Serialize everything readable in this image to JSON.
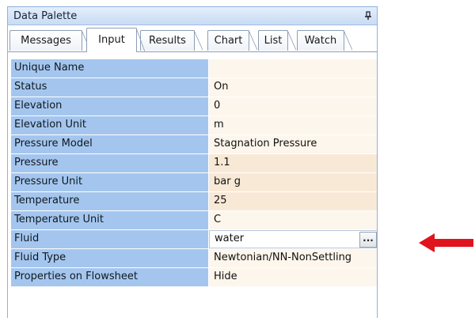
{
  "panel": {
    "title": "Data Palette",
    "pin_icon": "pin-icon"
  },
  "tabs": [
    {
      "label": "Messages",
      "active": false
    },
    {
      "label": "Input",
      "active": true
    },
    {
      "label": "Results",
      "active": false
    },
    {
      "label": "Chart",
      "active": false
    },
    {
      "label": "List",
      "active": false
    },
    {
      "label": "Watch",
      "active": false
    }
  ],
  "properties": [
    {
      "name": "Unique Name",
      "value": ""
    },
    {
      "name": "Status",
      "value": "On"
    },
    {
      "name": "Elevation",
      "value": "0"
    },
    {
      "name": "Elevation Unit",
      "value": "m"
    },
    {
      "name": "Pressure Model",
      "value": "Stagnation Pressure"
    },
    {
      "name": "Pressure",
      "value": "1.1"
    },
    {
      "name": "Pressure Unit",
      "value": "bar g"
    },
    {
      "name": "Temperature",
      "value": "25"
    },
    {
      "name": "Temperature Unit",
      "value": "C"
    },
    {
      "name": "Fluid",
      "value": "water",
      "button": "..."
    },
    {
      "name": "Fluid Type",
      "value": "Newtonian/NN-NonSettling"
    },
    {
      "name": "Properties on Flowsheet",
      "value": "Hide"
    }
  ],
  "colors": {
    "pointer_arrow": "#e0141c",
    "name_column": "#a4c6ee",
    "value_column": "#fdf6ec"
  }
}
